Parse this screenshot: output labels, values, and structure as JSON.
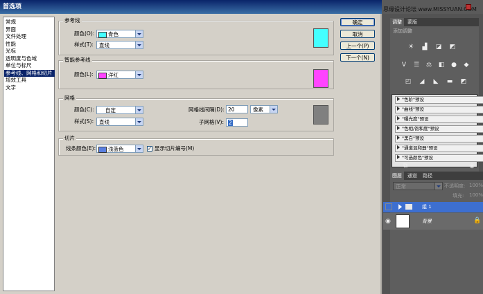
{
  "dialog": {
    "title": "首选项",
    "categories": [
      "常规",
      "界面",
      "文件处理",
      "性能",
      "光标",
      "透明度与色域",
      "单位与标尺",
      "参考线、网格和切片",
      "增效工具",
      "文字"
    ],
    "selected_index": 7,
    "buttons": {
      "ok": "确定",
      "cancel": "取消",
      "prev": "上一个(P)",
      "next": "下一个(N)"
    },
    "guides": {
      "title": "参考线",
      "color_label": "颜色(O):",
      "color_value": "青色",
      "color_hex": "#44ffff",
      "style_label": "样式(T):",
      "style_value": "直线"
    },
    "smart_guides": {
      "title": "智能参考线",
      "color_label": "颜色(L):",
      "color_value": "洋红",
      "color_hex": "#ff44ff"
    },
    "grid": {
      "title": "网格",
      "color_label": "颜色(C):",
      "color_value": "自定",
      "style_label": "样式(S):",
      "style_value": "直线",
      "gridline_label": "网格线间隔(D):",
      "gridline_value": "20",
      "unit_value": "像素",
      "subdiv_label": "子网格(V):",
      "subdiv_value": "2",
      "color_hex": "#808080"
    },
    "slices": {
      "title": "切片",
      "line_color_label": "线条颜色(E):",
      "line_color_value": "浅蓝色",
      "line_color_hex": "#5a7fe0",
      "show_numbers_label": "显示切片编号(M)",
      "show_numbers_checked": "✓"
    }
  },
  "watermark": "思缘设计论坛 www.MISSYUAN.COM",
  "adjustments": {
    "tabs": [
      "调整",
      "蒙版"
    ],
    "subtitle": "添加调整",
    "presets": [
      "\"色阶\"预设",
      "\"曲线\"预设",
      "\"曝光度\"预设",
      "\"色相/饱和度\"预设",
      "\"黑白\"预设",
      "\"通道混和器\"预设",
      "\"可选颜色\"预设"
    ]
  },
  "layers": {
    "tabs": [
      "图层",
      "通道",
      "路径"
    ],
    "blend_mode": "正常",
    "opacity_label": "不透明度:",
    "opacity_value": "100%",
    "fill_label": "填充:",
    "fill_value": "100%",
    "items": [
      {
        "name": "组 1"
      },
      {
        "name": "背景"
      }
    ]
  }
}
